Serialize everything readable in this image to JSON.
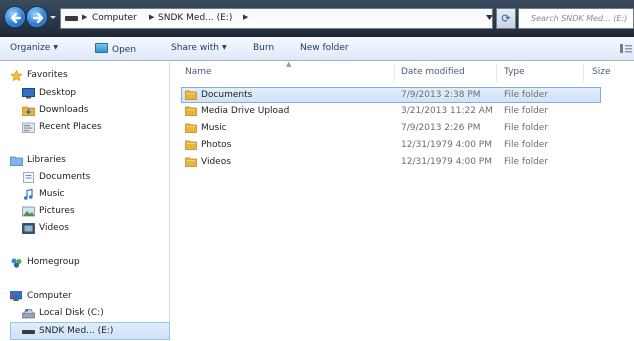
{
  "address_bar": {
    "breadcrumbs": [
      "Computer",
      "SNDK Med... (E:)"
    ],
    "search_placeholder": "Search SNDK Med... (E:)"
  },
  "toolbar": {
    "organize": "Organize",
    "open": "Open",
    "share_with": "Share with",
    "burn": "Burn",
    "new_folder": "New folder"
  },
  "navigation": {
    "favorites": {
      "label": "Favorites",
      "items": [
        "Desktop",
        "Downloads",
        "Recent Places"
      ]
    },
    "libraries": {
      "label": "Libraries",
      "items": [
        "Documents",
        "Music",
        "Pictures",
        "Videos"
      ]
    },
    "homegroup": {
      "label": "Homegroup"
    },
    "computer": {
      "label": "Computer",
      "items": [
        "Local Disk (C:)",
        "SNDK Med... (E:)"
      ],
      "selected_index": 1
    }
  },
  "file_list": {
    "columns": [
      "Name",
      "Date modified",
      "Type",
      "Size"
    ],
    "sort_column": "Name",
    "rows": [
      {
        "name": "Documents",
        "date": "7/9/2013 2:38 PM",
        "type": "File folder",
        "size": ""
      },
      {
        "name": "Media Drive Upload",
        "date": "3/21/2013 11:22 AM",
        "type": "File folder",
        "size": ""
      },
      {
        "name": "Music",
        "date": "7/9/2013 2:26 PM",
        "type": "File folder",
        "size": ""
      },
      {
        "name": "Photos",
        "date": "12/31/1979 4:00 PM",
        "type": "File folder",
        "size": ""
      },
      {
        "name": "Videos",
        "date": "12/31/1979 4:00 PM",
        "type": "File folder",
        "size": ""
      }
    ],
    "selected_index": 0
  },
  "colors": {
    "titlebar": "#2a3747",
    "selection": "#cfe3f8",
    "folder": "#e8b43a",
    "link_text": "#1e395b"
  },
  "icons": {
    "back": "back-arrow-icon",
    "forward": "forward-arrow-icon",
    "refresh": "refresh-icon",
    "search": "search-icon",
    "folder": "folder-icon",
    "favorites": "star-icon",
    "libraries": "library-icon",
    "homegroup": "homegroup-icon",
    "computer": "computer-icon",
    "drive": "drive-icon"
  }
}
